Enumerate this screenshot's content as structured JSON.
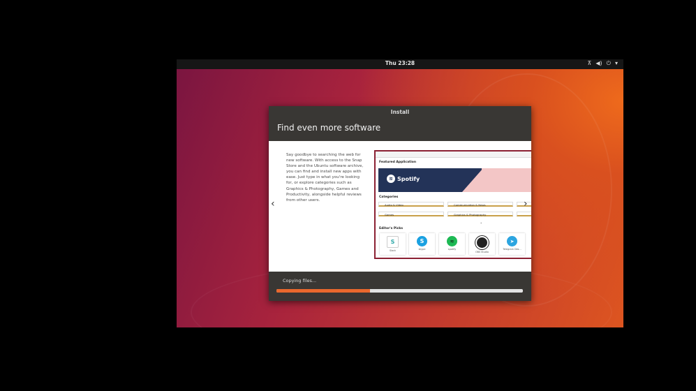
{
  "topbar": {
    "clock": "Thu 23:28",
    "icons": [
      "network-icon",
      "volume-icon",
      "power-icon",
      "menu-arrow-icon"
    ]
  },
  "dialog": {
    "title": "Install",
    "heading": "Find even more software",
    "description": "Say goodbye to searching the web for new software. With access to the Snap Store and the Ubuntu software archive, you can find and install new apps with ease. Just type in what you're looking for, or explore categories such as Graphics & Photography, Games and Productivity, alongside helpful reviews from other users.",
    "prev_arrow": "‹",
    "next_arrow": "›"
  },
  "preview": {
    "featured_title": "Featured Application",
    "banner_text": "Spotify",
    "categories_title": "Categories",
    "categories": [
      "Audio & Video",
      "Communication & News",
      "Games",
      "Graphics & Photography"
    ],
    "picks_title": "Editor's Picks",
    "picks": [
      {
        "name": "Slack",
        "color": "#ffffff"
      },
      {
        "name": "skype",
        "color": "#1aa1e1"
      },
      {
        "name": "spotify",
        "color": "#1db954"
      },
      {
        "name": "OBS Studio",
        "color": "#222222"
      },
      {
        "name": "Telegram Des...",
        "color": "#2ca5e0"
      }
    ]
  },
  "progress": {
    "label": "Copying files...",
    "fraction": 0.38,
    "fill_color": "#e9682d"
  }
}
